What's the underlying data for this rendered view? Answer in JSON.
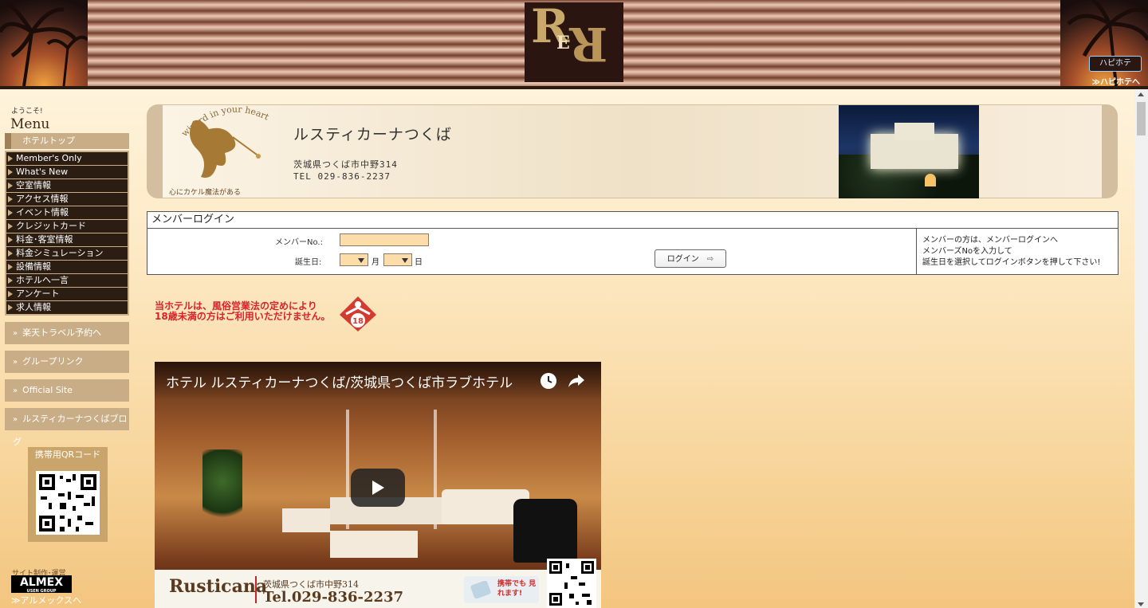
{
  "header": {
    "logo_letters": [
      "R",
      "E",
      "R"
    ],
    "happyhotel_badge": "ハピホテ",
    "happyhotel_link": "≫ハピホテへ"
  },
  "sidebar": {
    "welcome": "ようこそ!",
    "menu_title": "Menu",
    "hotel_top": "ホテルトップ",
    "items": [
      {
        "label": "Member's Only"
      },
      {
        "label": "What's New"
      },
      {
        "label": "空室情報"
      },
      {
        "label": "アクセス情報"
      },
      {
        "label": "イベント情報"
      },
      {
        "label": "クレジットカード"
      },
      {
        "label": "料金･客室情報"
      },
      {
        "label": "料金シミュレーション"
      },
      {
        "label": "設備情報"
      },
      {
        "label": "ホテルへ一言"
      },
      {
        "label": "アンケート"
      },
      {
        "label": "求人情報"
      }
    ],
    "buttons": [
      {
        "label": "楽天トラベル予約へ"
      },
      {
        "label": "グループリンク"
      },
      {
        "label": "Official Site"
      },
      {
        "label": "ルスティカーナつくばブログ"
      }
    ],
    "qr_label": "携帯用QRコード",
    "credit": "サイト制作･運営",
    "almex_logo": "ALMEX",
    "almex_sub": "USEN GROUP",
    "almex_link": "≫アルメックスへ"
  },
  "banner": {
    "title": "ルスティカーナつくば",
    "address": "茨城県つくば市中野314",
    "tel": "TEL 029-836-2237",
    "logo_arc": "wizard in your heart",
    "logo_caption": "心にカケル魔法がある"
  },
  "login": {
    "heading": "メンバーログイン",
    "member_label": "メンバーNo.:",
    "birth_label": "誕生日:",
    "month_label": "月",
    "day_label": "日",
    "button_label": "ログイン",
    "member_value": "",
    "note_lines": [
      "メンバーの方は、メンバーログインへ",
      "メンバーズNoを入力して",
      "誕生日を選択してログインボタンを押して下さい!"
    ]
  },
  "warning": {
    "line1": "当ホテルは、風俗営業法の定めにより",
    "line2": "18歳未満の方はご利用いただけません。",
    "badge": "18"
  },
  "video": {
    "title": "ホテル ルスティカーナつくば/茨城県つくば市ラブホテル",
    "footer_logo": "Rusticana",
    "footer_address": "茨城県つくば市中野314",
    "footer_tel": "Tel.029-836-2237",
    "footer_mobile": "携帯でも 見れます!"
  },
  "colors": {
    "accent": "#c9ad86",
    "nav_bg": "#2b1d12",
    "warning": "#d7232a"
  }
}
